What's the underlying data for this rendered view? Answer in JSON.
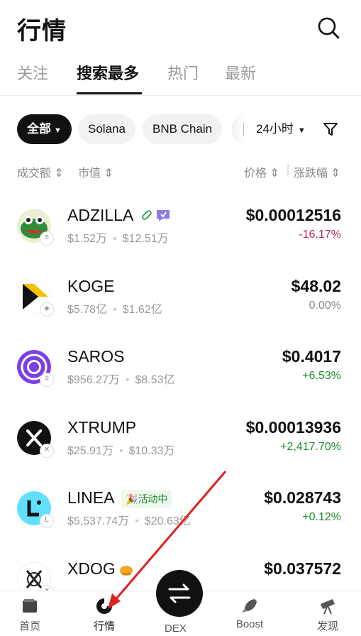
{
  "header": {
    "title": "行情"
  },
  "tabs": [
    {
      "label": "关注"
    },
    {
      "label": "搜索最多"
    },
    {
      "label": "热门"
    },
    {
      "label": "最新"
    }
  ],
  "filters": {
    "chips": [
      {
        "label": "全部"
      },
      {
        "label": "Solana"
      },
      {
        "label": "BNB Chain"
      }
    ],
    "time_range": "24小时"
  },
  "sort": {
    "volume": "成交额 ⇕",
    "market_cap": "市值 ⇕",
    "price": "价格 ⇕",
    "change": "涨跌幅 ⇕"
  },
  "tokens": [
    {
      "symbol": "ADZILLA",
      "volume": "$1.52万",
      "market_cap": "$12.51万",
      "price": "$0.00012516",
      "change": "-16.17%",
      "trend": "neg"
    },
    {
      "symbol": "KOGE",
      "volume": "$5.78亿",
      "market_cap": "$1.62亿",
      "price": "$48.02",
      "change": "0.00%",
      "trend": "zero"
    },
    {
      "symbol": "SAROS",
      "volume": "$956.27万",
      "market_cap": "$8.53亿",
      "price": "$0.4017",
      "change": "+6.53%",
      "trend": "pos"
    },
    {
      "symbol": "XTRUMP",
      "volume": "$25.91万",
      "market_cap": "$10.33万",
      "price": "$0.00013936",
      "change": "+2,417.70%",
      "trend": "pos"
    },
    {
      "symbol": "LINEA",
      "badge": "活动中",
      "volume": "$5,537.74万",
      "market_cap": "$20.63亿",
      "price": "$0.028743",
      "change": "+0.12%",
      "trend": "pos"
    },
    {
      "symbol": "XDOG",
      "volume": "",
      "market_cap": "",
      "price": "$0.037572",
      "change": "",
      "trend": "neg"
    }
  ],
  "bottom_nav": [
    {
      "label": "首页"
    },
    {
      "label": "行情"
    },
    {
      "label": "DEX"
    },
    {
      "label": "Boost"
    },
    {
      "label": "发现"
    }
  ],
  "colors": {
    "positive": "#1e8b2e",
    "negative": "#b0285a",
    "annotation_arrow": "#e02020"
  }
}
